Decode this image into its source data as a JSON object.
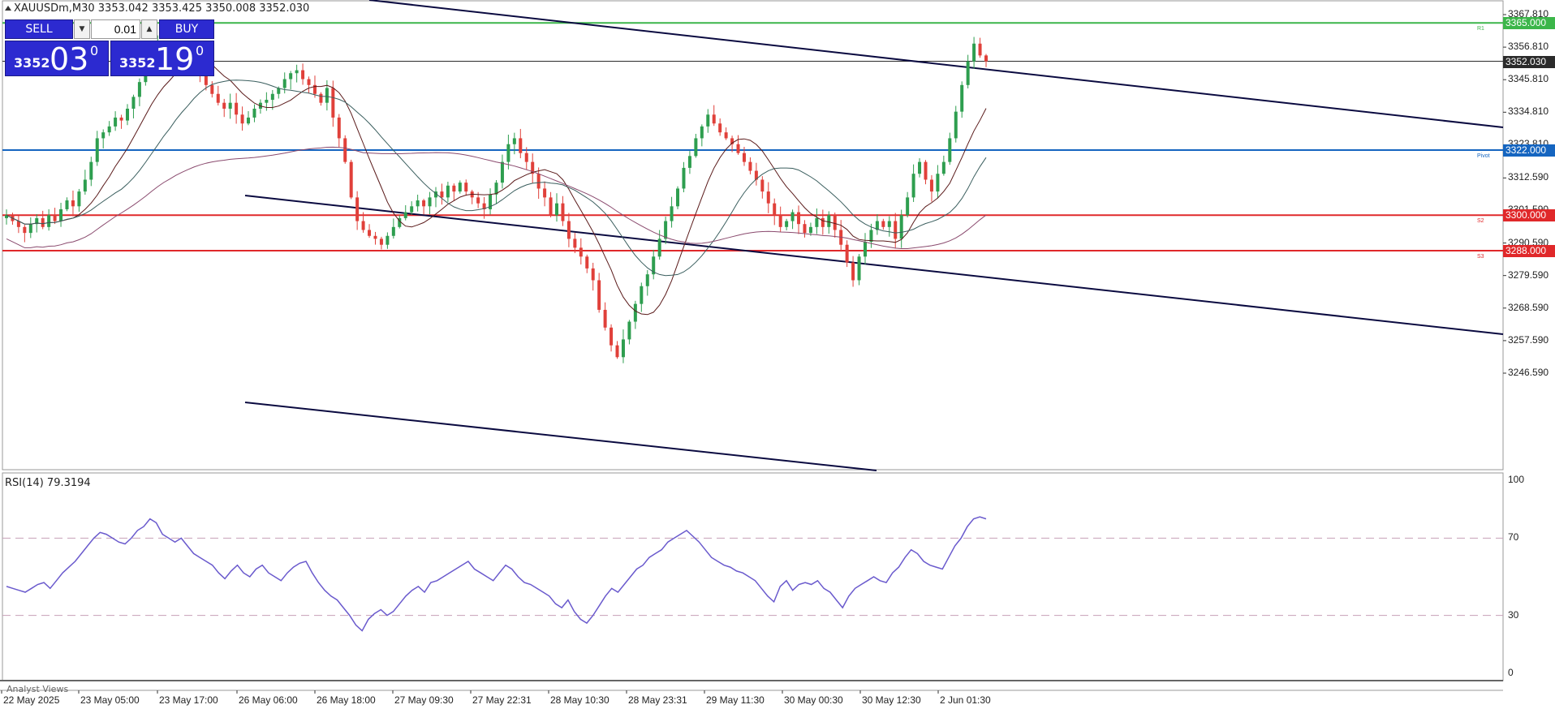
{
  "header": {
    "title": "XAUUSDm,M30  3353.042 3353.425 3350.008 3352.030"
  },
  "trade_panel": {
    "sell_label": "SELL",
    "buy_label": "BUY",
    "lot": "0.01",
    "sell_price_small": "3352",
    "sell_price_big": "03",
    "sell_price_sup": "0",
    "buy_price_small": "3352",
    "buy_price_big": "19",
    "buy_price_sup": "0"
  },
  "price_axis": {
    "labels": [
      "3367.810",
      "3356.810",
      "3345.810",
      "3334.810",
      "3323.810",
      "3312.590",
      "3301.590",
      "3290.590",
      "3279.590",
      "3268.590",
      "3257.590",
      "3246.590"
    ],
    "label_values": [
      3367.81,
      3356.81,
      3345.81,
      3334.81,
      3323.81,
      3312.59,
      3301.59,
      3290.59,
      3279.59,
      3268.59,
      3257.59,
      3246.59
    ]
  },
  "horizontal_lines": [
    {
      "price": 3365.0,
      "label": "3365.000",
      "color": "#3cb64a",
      "tag": "R1"
    },
    {
      "price": 3352.03,
      "label": "3352.030",
      "color": "#2b2b2b",
      "tag": ""
    },
    {
      "price": 3322.0,
      "label": "3322.000",
      "color": "#1565c0",
      "tag": "Pivot"
    },
    {
      "price": 3300.0,
      "label": "3300.000",
      "color": "#e0282a",
      "tag": "S2"
    },
    {
      "price": 3288.0,
      "label": "3288.000",
      "color": "#e0282a",
      "tag": "S3"
    }
  ],
  "time_axis": {
    "labels": [
      "22 May 2025",
      "23 May 05:00",
      "23 May 17:00",
      "26 May 06:00",
      "26 May 18:00",
      "27 May 09:30",
      "27 May 22:31",
      "28 May 10:30",
      "28 May 23:31",
      "29 May 11:30",
      "30 May 00:30",
      "30 May 12:30",
      "2 Jun 01:30"
    ]
  },
  "rsi": {
    "label": "RSI(14) 79.3194",
    "axis_labels": [
      "100",
      "70",
      "30",
      "0"
    ],
    "levels": [
      70,
      30
    ]
  },
  "footer": {
    "analyst_views": "Analyst Views"
  },
  "chart_data": {
    "type": "candlestick",
    "symbol": "XAUUSDm",
    "timeframe": "M30",
    "ylim": [
      3244,
      3371
    ],
    "closes": [
      3300,
      3298,
      3296,
      3294,
      3297,
      3299,
      3296,
      3300,
      3298,
      3302,
      3305,
      3303,
      3308,
      3312,
      3318,
      3326,
      3328,
      3330,
      3333,
      3332,
      3336,
      3340,
      3345,
      3350,
      3355,
      3358,
      3355,
      3352,
      3356,
      3353,
      3350,
      3352,
      3348,
      3344,
      3341,
      3338,
      3336,
      3338,
      3334,
      3331,
      3333,
      3336,
      3338,
      3339,
      3341,
      3343,
      3346,
      3348,
      3349,
      3346,
      3344,
      3341,
      3338,
      3343,
      3333,
      3326,
      3318,
      3306,
      3298,
      3295,
      3293,
      3292,
      3290,
      3293,
      3296,
      3299,
      3301,
      3303,
      3305,
      3303,
      3306,
      3308,
      3306,
      3310,
      3308,
      3311,
      3308,
      3306,
      3304,
      3302,
      3307,
      3311,
      3318,
      3324,
      3326,
      3321,
      3318,
      3314,
      3309,
      3306,
      3300,
      3304,
      3298,
      3292,
      3289,
      3286,
      3282,
      3278,
      3268,
      3262,
      3256,
      3252,
      3258,
      3264,
      3270,
      3276,
      3280,
      3286,
      3292,
      3298,
      3303,
      3309,
      3316,
      3320,
      3326,
      3330,
      3334,
      3331,
      3328,
      3326,
      3324,
      3321,
      3318,
      3315,
      3312,
      3308,
      3304,
      3300,
      3296,
      3298,
      3301,
      3297,
      3294,
      3296,
      3299,
      3296,
      3300,
      3295,
      3290,
      3284,
      3278,
      3286,
      3291,
      3295,
      3298,
      3296,
      3298,
      3292,
      3300,
      3306,
      3314,
      3318,
      3312,
      3308,
      3314,
      3318,
      3326,
      3335,
      3344,
      3352,
      3358,
      3354,
      3352
    ],
    "indicators": [
      "MA fast",
      "MA mid",
      "MA slow"
    ],
    "rsi_values": [
      45,
      44,
      43,
      42,
      44,
      46,
      47,
      44,
      48,
      52,
      55,
      58,
      62,
      66,
      70,
      73,
      72,
      70,
      68,
      67,
      70,
      74,
      76,
      80,
      78,
      72,
      70,
      68,
      70,
      66,
      62,
      60,
      58,
      56,
      52,
      49,
      53,
      56,
      52,
      50,
      54,
      56,
      52,
      50,
      48,
      52,
      55,
      57,
      58,
      52,
      47,
      43,
      40,
      38,
      34,
      30,
      25,
      22,
      28,
      31,
      33,
      30,
      32,
      36,
      40,
      43,
      45,
      42,
      47,
      48,
      50,
      52,
      54,
      56,
      58,
      54,
      52,
      50,
      48,
      52,
      56,
      54,
      50,
      47,
      46,
      44,
      42,
      40,
      36,
      34,
      38,
      32,
      28,
      26,
      30,
      35,
      40,
      44,
      42,
      46,
      50,
      54,
      56,
      60,
      62,
      64,
      68,
      70,
      72,
      74,
      71,
      68,
      64,
      60,
      58,
      56,
      55,
      53,
      52,
      50,
      48,
      44,
      40,
      37,
      45,
      48,
      43,
      46,
      47,
      46,
      48,
      44,
      42,
      38,
      34,
      40,
      44,
      46,
      48,
      50,
      48,
      47,
      52,
      55,
      60,
      64,
      62,
      58,
      56,
      55,
      54,
      60,
      66,
      70,
      76,
      80,
      81,
      80
    ],
    "channels": "descending parallel channel (three lines)"
  }
}
